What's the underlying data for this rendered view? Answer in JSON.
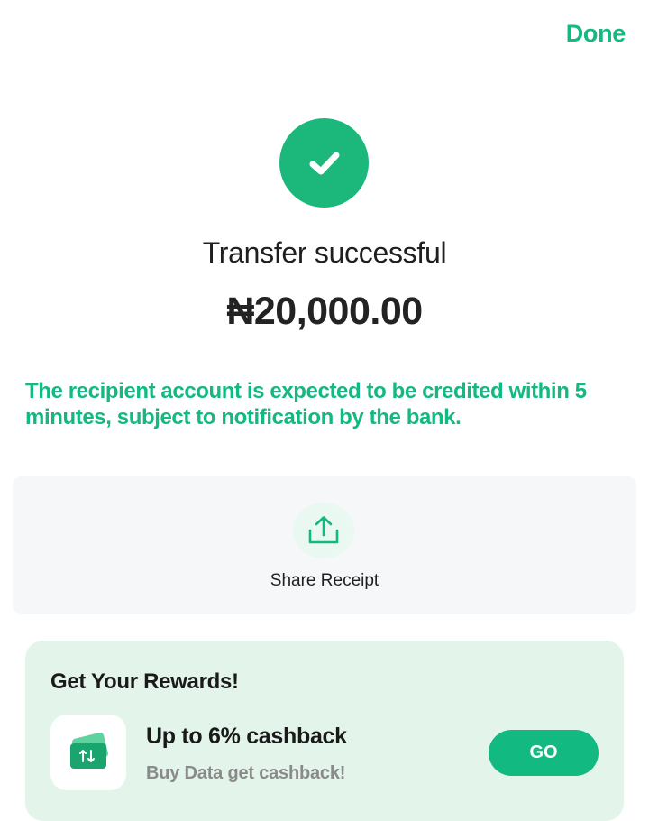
{
  "header": {
    "done_label": "Done"
  },
  "status": {
    "icon": "check-icon",
    "title": "Transfer successful",
    "amount": "₦20,000.00",
    "notice": "The recipient account is expected to be credited within 5 minutes, subject to notification by the bank."
  },
  "share": {
    "icon": "share-upload-icon",
    "label": "Share Receipt"
  },
  "rewards": {
    "title": "Get Your Rewards!",
    "promo": {
      "icon": "data-card-icon",
      "title": "Up to 6% cashback",
      "subtitle": "Buy Data get cashback!",
      "button_label": "GO"
    }
  },
  "colors": {
    "accent": "#12b981",
    "success_circle": "#1cb87b",
    "rewards_bg": "#e3f5eb",
    "share_bg": "#f6f7f9"
  }
}
